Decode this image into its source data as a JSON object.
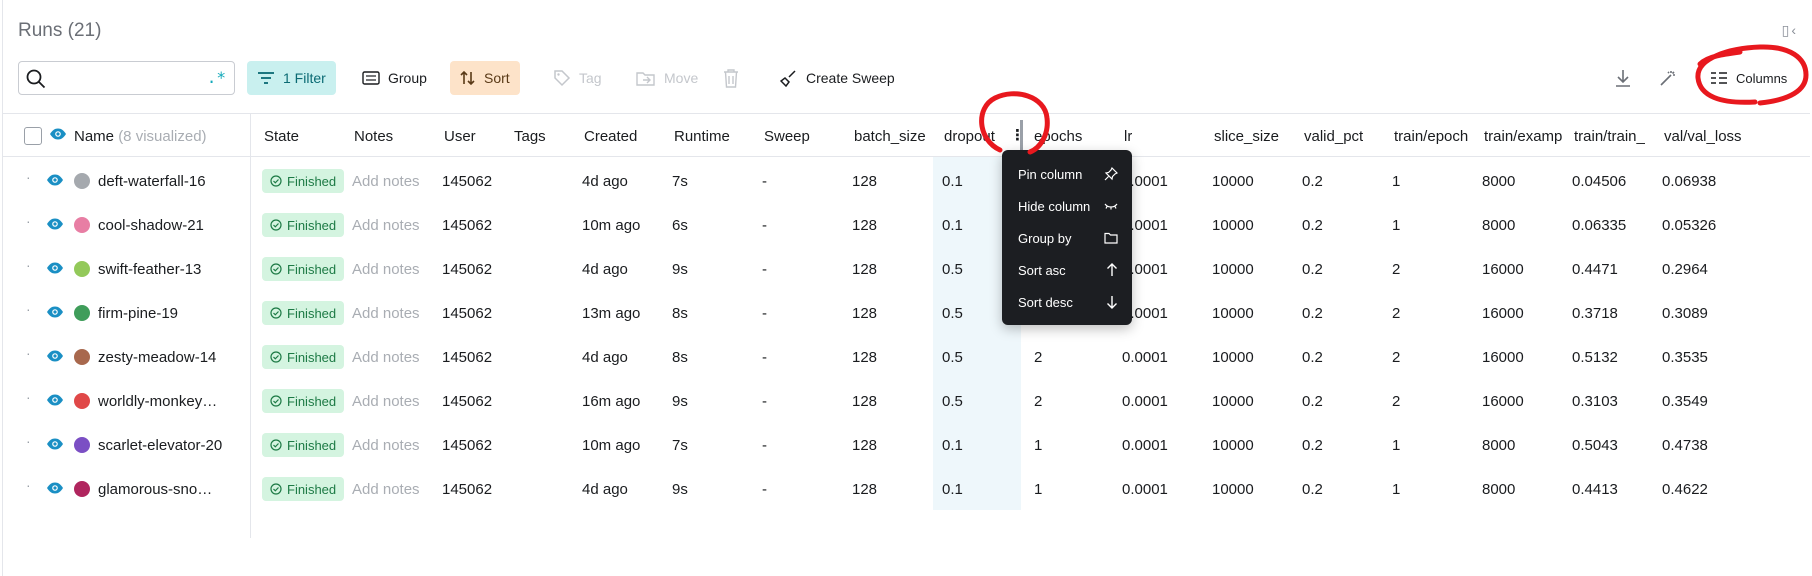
{
  "header": {
    "title": "Runs (21)"
  },
  "toolbar": {
    "filter_label": "1 Filter",
    "group_label": "Group",
    "sort_label": "Sort",
    "tag_label": "Tag",
    "move_label": "Move",
    "create_sweep_label": "Create Sweep",
    "columns_label": "Columns",
    "search_value": "",
    "regex_symbol": ".*"
  },
  "table": {
    "name_header": "Name",
    "name_header_suffix": "(8 visualized)",
    "columns": [
      "State",
      "Notes",
      "User",
      "Tags",
      "Created",
      "Runtime",
      "Sweep",
      "batch_size",
      "dropout",
      "epochs",
      "lr",
      "slice_size",
      "valid_pct",
      "train/epoch",
      "train/examp",
      "train/train_",
      "val/val_loss"
    ],
    "rows": [
      {
        "name": "deft-waterfall-16",
        "color": "#a5a9ae",
        "state": "Finished",
        "notes": "Add notes",
        "user": "145062",
        "tags": "",
        "created": "4d ago",
        "runtime": "7s",
        "sweep": "-",
        "batch_size": "128",
        "dropout": "0.1",
        "epochs": "",
        "lr": "0.0001",
        "slice_size": "10000",
        "valid_pct": "0.2",
        "train_epoch": "1",
        "train_examples": "8000",
        "train_loss": "0.04506",
        "val_loss": "0.06938"
      },
      {
        "name": "cool-shadow-21",
        "color": "#e87ea4",
        "state": "Finished",
        "notes": "Add notes",
        "user": "145062",
        "tags": "",
        "created": "10m ago",
        "runtime": "6s",
        "sweep": "-",
        "batch_size": "128",
        "dropout": "0.1",
        "epochs": "",
        "lr": "0.0001",
        "slice_size": "10000",
        "valid_pct": "0.2",
        "train_epoch": "1",
        "train_examples": "8000",
        "train_loss": "0.06335",
        "val_loss": "0.05326"
      },
      {
        "name": "swift-feather-13",
        "color": "#93c95a",
        "state": "Finished",
        "notes": "Add notes",
        "user": "145062",
        "tags": "",
        "created": "4d ago",
        "runtime": "9s",
        "sweep": "-",
        "batch_size": "128",
        "dropout": "0.5",
        "epochs": "",
        "lr": "0.0001",
        "slice_size": "10000",
        "valid_pct": "0.2",
        "train_epoch": "2",
        "train_examples": "16000",
        "train_loss": "0.4471",
        "val_loss": "0.2964"
      },
      {
        "name": "firm-pine-19",
        "color": "#3f9d5a",
        "state": "Finished",
        "notes": "Add notes",
        "user": "145062",
        "tags": "",
        "created": "13m ago",
        "runtime": "8s",
        "sweep": "-",
        "batch_size": "128",
        "dropout": "0.5",
        "epochs": "",
        "lr": "0.0001",
        "slice_size": "10000",
        "valid_pct": "0.2",
        "train_epoch": "2",
        "train_examples": "16000",
        "train_loss": "0.3718",
        "val_loss": "0.3089"
      },
      {
        "name": "zesty-meadow-14",
        "color": "#a8684d",
        "state": "Finished",
        "notes": "Add notes",
        "user": "145062",
        "tags": "",
        "created": "4d ago",
        "runtime": "8s",
        "sweep": "-",
        "batch_size": "128",
        "dropout": "0.5",
        "epochs": "2",
        "lr": "0.0001",
        "slice_size": "10000",
        "valid_pct": "0.2",
        "train_epoch": "2",
        "train_examples": "16000",
        "train_loss": "0.5132",
        "val_loss": "0.3535"
      },
      {
        "name": "worldly-monkey…",
        "color": "#e04848",
        "state": "Finished",
        "notes": "Add notes",
        "user": "145062",
        "tags": "",
        "created": "16m ago",
        "runtime": "9s",
        "sweep": "-",
        "batch_size": "128",
        "dropout": "0.5",
        "epochs": "2",
        "lr": "0.0001",
        "slice_size": "10000",
        "valid_pct": "0.2",
        "train_epoch": "2",
        "train_examples": "16000",
        "train_loss": "0.3103",
        "val_loss": "0.3549"
      },
      {
        "name": "scarlet-elevator-20",
        "color": "#7b4fc4",
        "state": "Finished",
        "notes": "Add notes",
        "user": "145062",
        "tags": "",
        "created": "10m ago",
        "runtime": "7s",
        "sweep": "-",
        "batch_size": "128",
        "dropout": "0.1",
        "epochs": "1",
        "lr": "0.0001",
        "slice_size": "10000",
        "valid_pct": "0.2",
        "train_epoch": "1",
        "train_examples": "8000",
        "train_loss": "0.5043",
        "val_loss": "0.4738"
      },
      {
        "name": "glamorous-sno…",
        "color": "#b0255e",
        "state": "Finished",
        "notes": "Add notes",
        "user": "145062",
        "tags": "",
        "created": "4d ago",
        "runtime": "9s",
        "sweep": "-",
        "batch_size": "128",
        "dropout": "0.1",
        "epochs": "1",
        "lr": "0.0001",
        "slice_size": "10000",
        "valid_pct": "0.2",
        "train_epoch": "1",
        "train_examples": "8000",
        "train_loss": "0.4413",
        "val_loss": "0.4622"
      }
    ]
  },
  "context_menu": {
    "items": [
      {
        "label": "Pin column",
        "icon": "pin-icon"
      },
      {
        "label": "Hide column",
        "icon": "eye-closed-icon"
      },
      {
        "label": "Group by",
        "icon": "folder-icon"
      },
      {
        "label": "Sort asc",
        "icon": "arrow-up-icon"
      },
      {
        "label": "Sort desc",
        "icon": "arrow-down-icon"
      }
    ]
  },
  "colors": {
    "accent_teal": "#13a9ba",
    "filter_bg": "#c9f0ef",
    "sort_bg": "#fde3c9",
    "finished_bg": "#d4f4e0",
    "annotation_red": "#e8181e"
  }
}
